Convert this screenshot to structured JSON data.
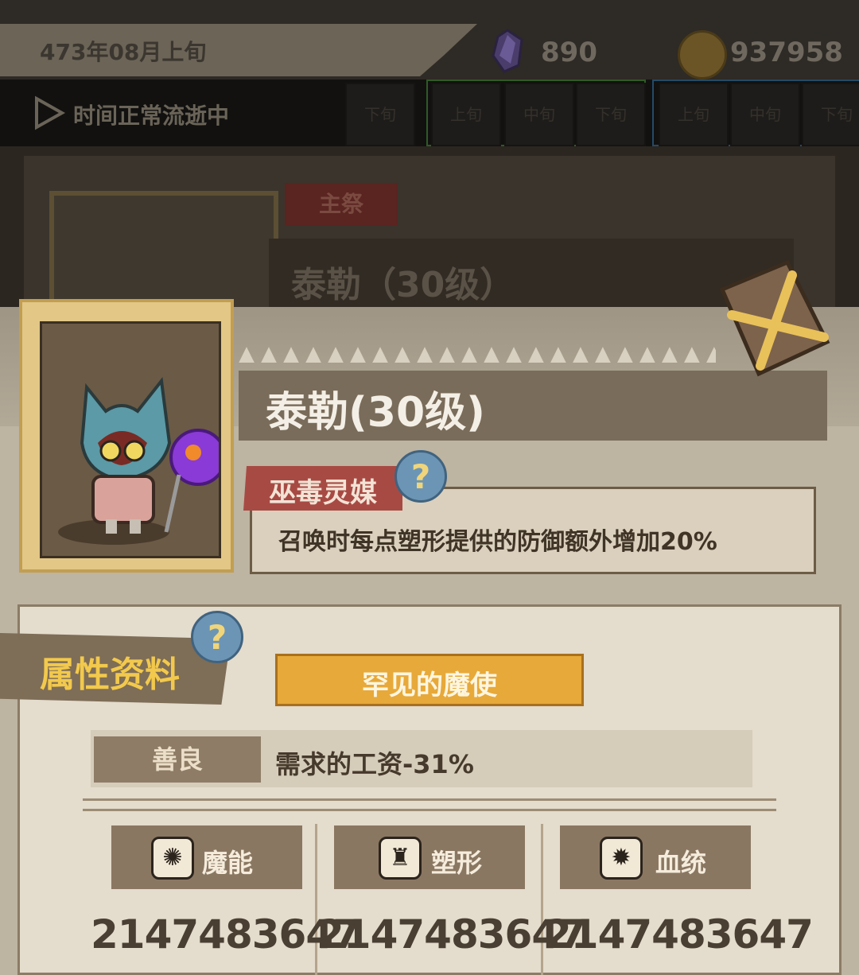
{
  "hud": {
    "date": "473年08月上旬",
    "gems": "890",
    "gold": "937958",
    "time_status": "时间正常流逝中",
    "slots": [
      "下旬",
      "上旬",
      "中旬",
      "下旬",
      "上旬",
      "中旬",
      "下旬"
    ]
  },
  "background": {
    "role_tag": "主祭",
    "name": "泰勒（30级）"
  },
  "character": {
    "name": "泰勒(30级)",
    "trait_name": "巫毒灵媒",
    "trait_desc": "召唤时每点塑形提供的防御额外增加20%",
    "close_icon": "crossed-swords-close-icon"
  },
  "attributes": {
    "title": "属性资料",
    "rank": "罕见的魔使",
    "alignment": "善良",
    "alignment_effect": "需求的工资-31%",
    "stats": [
      {
        "label": "魔能",
        "value": "2147483647",
        "icon": "magic-orb-icon"
      },
      {
        "label": "塑形",
        "value": "2147483647",
        "icon": "torso-icon"
      },
      {
        "label": "血统",
        "value": "2147483647",
        "icon": "blood-gear-icon"
      }
    ]
  },
  "help_symbol": "?",
  "colors": {
    "accent_gold": "#f2c94c",
    "trait_red": "#a84a44",
    "rank_orange": "#e7a93a"
  }
}
